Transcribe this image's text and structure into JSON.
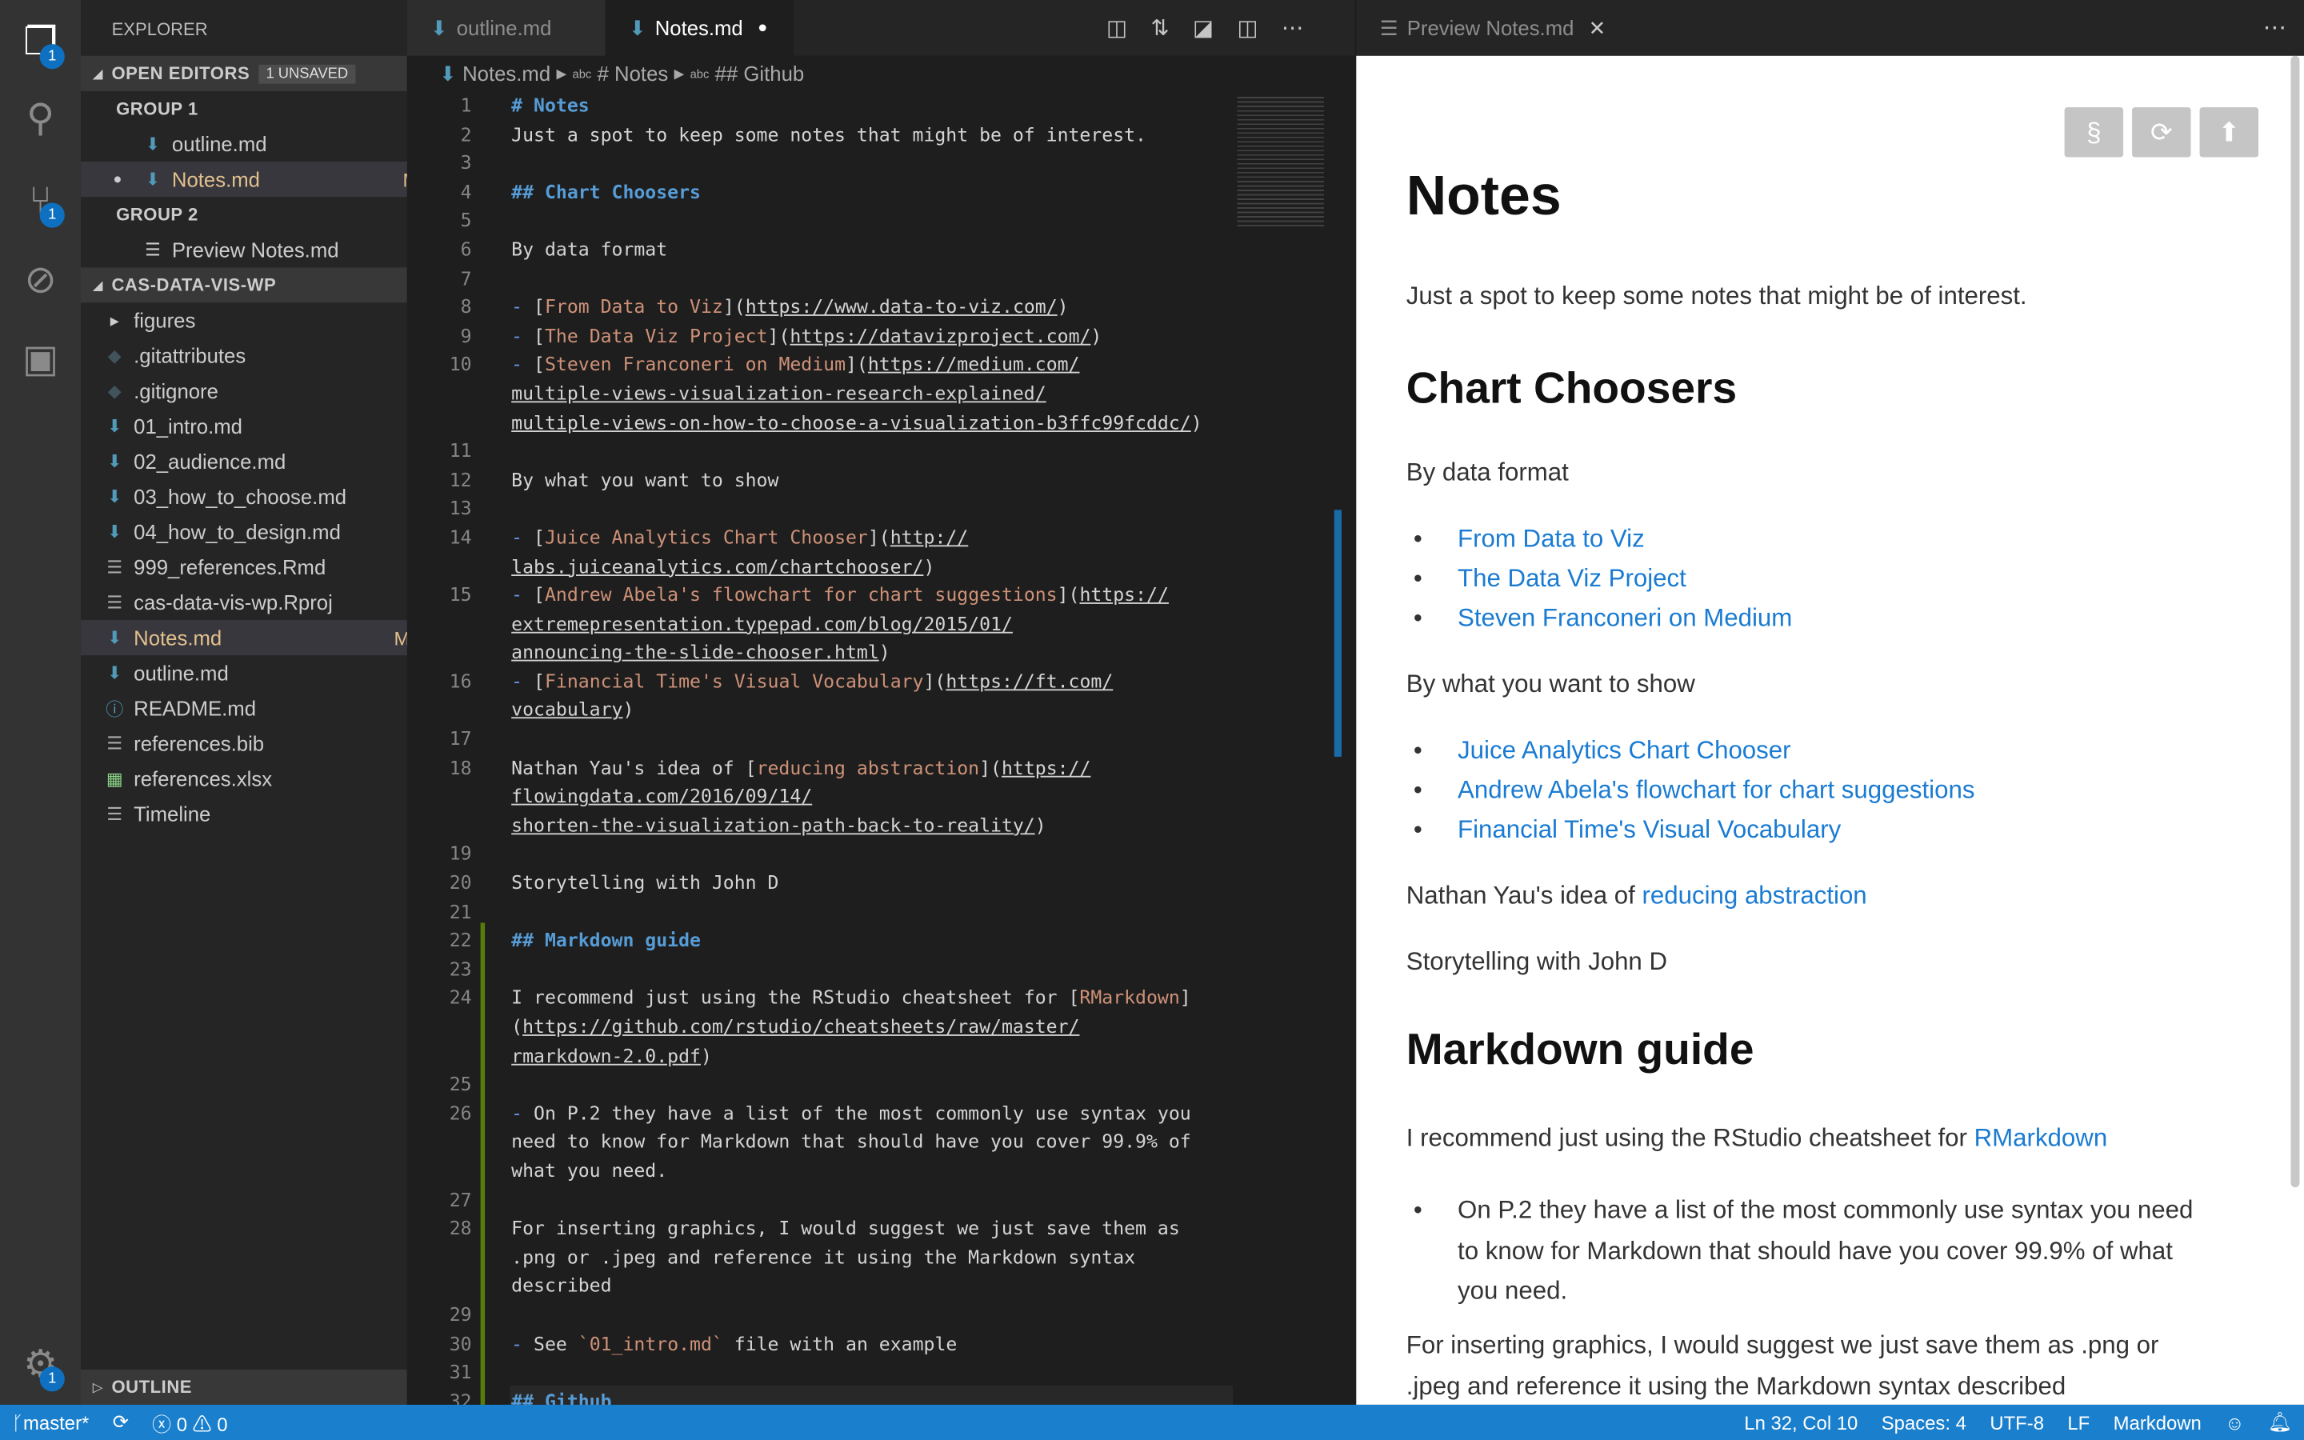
{
  "activity": {
    "explorer_badge": "1",
    "scm_badge": "1",
    "settings_badge": "1"
  },
  "sidebar": {
    "title": "EXPLORER",
    "open_editors": "OPEN EDITORS",
    "unsaved": "1 UNSAVED",
    "group1": "GROUP 1",
    "group2": "GROUP 2",
    "g1_items": [
      {
        "label": "outline.md"
      },
      {
        "label": "Notes.md",
        "flag": "M"
      }
    ],
    "g2_items": [
      {
        "label": "Preview Notes.md"
      }
    ],
    "folder": "CAS-DATA-VIS-WP",
    "files": [
      {
        "label": "figures",
        "icon": "folder"
      },
      {
        "label": ".gitattributes",
        "icon": "git"
      },
      {
        "label": ".gitignore",
        "icon": "git"
      },
      {
        "label": "01_intro.md",
        "icon": "md"
      },
      {
        "label": "02_audience.md",
        "icon": "md"
      },
      {
        "label": "03_how_to_choose.md",
        "icon": "md"
      },
      {
        "label": "04_how_to_design.md",
        "icon": "md"
      },
      {
        "label": "999_references.Rmd",
        "icon": "lines"
      },
      {
        "label": "cas-data-vis-wp.Rproj",
        "icon": "lines"
      },
      {
        "label": "Notes.md",
        "icon": "md",
        "flag": "M"
      },
      {
        "label": "outline.md",
        "icon": "md"
      },
      {
        "label": "README.md",
        "icon": "info"
      },
      {
        "label": "references.bib",
        "icon": "lines"
      },
      {
        "label": "references.xlsx",
        "icon": "xls"
      },
      {
        "label": "Timeline",
        "icon": "lines"
      }
    ],
    "outline": "OUTLINE"
  },
  "tabs": [
    {
      "label": "outline.md"
    },
    {
      "label": "Notes.md"
    }
  ],
  "breadcrumb": [
    "Notes.md",
    "# Notes",
    "## Github"
  ],
  "breadcrumb_abc": "abc",
  "code": [
    {
      "n": "1",
      "s": [
        [
          "h",
          "# Notes"
        ]
      ]
    },
    {
      "n": "2",
      "s": [
        [
          "p",
          "Just a spot to keep some notes that might be of interest."
        ]
      ]
    },
    {
      "n": "3",
      "s": []
    },
    {
      "n": "4",
      "s": [
        [
          "h",
          "## Chart Choosers"
        ]
      ]
    },
    {
      "n": "5",
      "s": []
    },
    {
      "n": "6",
      "s": [
        [
          "p",
          "By data format"
        ]
      ]
    },
    {
      "n": "7",
      "s": []
    },
    {
      "n": "8",
      "s": [
        [
          "li",
          "- "
        ],
        [
          "p",
          "["
        ],
        [
          "lt",
          "From Data to Viz"
        ],
        [
          "p",
          "]("
        ],
        [
          "u",
          "https://www.data-to-viz.com/"
        ],
        [
          "p",
          ")"
        ]
      ]
    },
    {
      "n": "9",
      "s": [
        [
          "li",
          "- "
        ],
        [
          "p",
          "["
        ],
        [
          "lt",
          "The Data Viz Project"
        ],
        [
          "p",
          "]("
        ],
        [
          "u",
          "https://datavizproject.com/"
        ],
        [
          "p",
          ")"
        ]
      ]
    },
    {
      "n": "10",
      "s": [
        [
          "li",
          "- "
        ],
        [
          "p",
          "["
        ],
        [
          "lt",
          "Steven Franconeri on Medium"
        ],
        [
          "p",
          "]("
        ],
        [
          "u",
          "https://medium.com/"
        ]
      ]
    },
    {
      "n": "",
      "s": [
        [
          "u",
          "multiple-views-visualization-research-explained/"
        ]
      ]
    },
    {
      "n": "",
      "s": [
        [
          "u",
          "multiple-views-on-how-to-choose-a-visualization-b3ffc99fcddc/"
        ],
        [
          "p",
          ")"
        ]
      ]
    },
    {
      "n": "11",
      "s": []
    },
    {
      "n": "12",
      "s": [
        [
          "p",
          "By what you want to show"
        ]
      ]
    },
    {
      "n": "13",
      "s": []
    },
    {
      "n": "14",
      "s": [
        [
          "li",
          "- "
        ],
        [
          "p",
          "["
        ],
        [
          "lt",
          "Juice Analytics Chart Chooser"
        ],
        [
          "p",
          "]("
        ],
        [
          "u",
          "http://"
        ]
      ]
    },
    {
      "n": "",
      "s": [
        [
          "u",
          "labs.juiceanalytics.com/chartchooser/"
        ],
        [
          "p",
          ")"
        ]
      ]
    },
    {
      "n": "15",
      "s": [
        [
          "li",
          "- "
        ],
        [
          "p",
          "["
        ],
        [
          "lt",
          "Andrew Abela's flowchart for chart suggestions"
        ],
        [
          "p",
          "]("
        ],
        [
          "u",
          "https://"
        ]
      ]
    },
    {
      "n": "",
      "s": [
        [
          "u",
          "extremepresentation.typepad.com/blog/2015/01/"
        ]
      ]
    },
    {
      "n": "",
      "s": [
        [
          "u",
          "announcing-the-slide-chooser.html"
        ],
        [
          "p",
          ")"
        ]
      ]
    },
    {
      "n": "16",
      "s": [
        [
          "li",
          "- "
        ],
        [
          "p",
          "["
        ],
        [
          "lt",
          "Financial Time's Visual Vocabulary"
        ],
        [
          "p",
          "]("
        ],
        [
          "u",
          "https://ft.com/"
        ]
      ]
    },
    {
      "n": "",
      "s": [
        [
          "u",
          "vocabulary"
        ],
        [
          "p",
          ")"
        ]
      ]
    },
    {
      "n": "17",
      "s": []
    },
    {
      "n": "18",
      "s": [
        [
          "p",
          "Nathan Yau's idea of ["
        ],
        [
          "lt",
          "reducing abstraction"
        ],
        [
          "p",
          "]("
        ],
        [
          "u",
          "https://"
        ]
      ]
    },
    {
      "n": "",
      "s": [
        [
          "u",
          "flowingdata.com/2016/09/14/"
        ]
      ]
    },
    {
      "n": "",
      "s": [
        [
          "u",
          "shorten-the-visualization-path-back-to-reality/"
        ],
        [
          "p",
          ")"
        ]
      ]
    },
    {
      "n": "19",
      "s": []
    },
    {
      "n": "20",
      "s": [
        [
          "p",
          "Storytelling with John D"
        ]
      ]
    },
    {
      "n": "21",
      "s": []
    },
    {
      "n": "22",
      "s": [
        [
          "h",
          "## Markdown guide"
        ]
      ]
    },
    {
      "n": "23",
      "s": []
    },
    {
      "n": "24",
      "s": [
        [
          "p",
          "I recommend just using the RStudio cheatsheet for ["
        ],
        [
          "lt",
          "RMarkdown"
        ],
        [
          "p",
          "]"
        ]
      ]
    },
    {
      "n": "",
      "s": [
        [
          "p",
          "("
        ],
        [
          "u",
          "https://github.com/rstudio/cheatsheets/raw/master/"
        ]
      ]
    },
    {
      "n": "",
      "s": [
        [
          "u",
          "rmarkdown-2.0.pdf"
        ],
        [
          "p",
          ")"
        ]
      ]
    },
    {
      "n": "25",
      "s": []
    },
    {
      "n": "26",
      "s": [
        [
          "li",
          "- "
        ],
        [
          "p",
          "On P.2 they have a list of the most commonly use syntax you"
        ]
      ]
    },
    {
      "n": "",
      "s": [
        [
          "p",
          "need to know for Markdown that should have you cover 99.9% of"
        ]
      ]
    },
    {
      "n": "",
      "s": [
        [
          "p",
          "what you need."
        ]
      ]
    },
    {
      "n": "27",
      "s": []
    },
    {
      "n": "28",
      "s": [
        [
          "p",
          "For inserting graphics, I would suggest we just save them as"
        ]
      ]
    },
    {
      "n": "",
      "s": [
        [
          "p",
          ".png or .jpeg and reference it using the Markdown syntax"
        ]
      ]
    },
    {
      "n": "",
      "s": [
        [
          "p",
          "described"
        ]
      ]
    },
    {
      "n": "29",
      "s": []
    },
    {
      "n": "30",
      "s": [
        [
          "li",
          "- "
        ],
        [
          "p",
          "See "
        ],
        [
          "c",
          "`01_intro.md`"
        ],
        [
          "p",
          " file with an example"
        ]
      ]
    },
    {
      "n": "31",
      "s": []
    },
    {
      "n": "32",
      "s": [
        [
          "h",
          "## Github"
        ]
      ]
    }
  ],
  "preview": {
    "tab": "Preview Notes.md",
    "h1": "Notes",
    "intro": "Just a spot to keep some notes that might be of interest.",
    "h2_charts": "Chart Choosers",
    "by_format": "By data format",
    "format_links": [
      "From Data to Viz",
      "The Data Viz Project",
      "Steven Franconeri on Medium"
    ],
    "by_show": "By what you want to show",
    "show_links": [
      "Juice Analytics Chart Chooser",
      "Andrew Abela's flowchart for chart suggestions",
      "Financial Time's Visual Vocabulary"
    ],
    "nathan_prefix": "Nathan Yau's idea of ",
    "nathan_link": "reducing abstraction",
    "story": "Storytelling with John D",
    "h2_md": "Markdown guide",
    "recommend_prefix": "I recommend just using the RStudio cheatsheet for ",
    "recommend_link": "RMarkdown",
    "p2_lines": [
      "On P.2 they have a list of the most commonly use syntax you need",
      "to know for Markdown that should have you cover 99.9% of what",
      "you need."
    ],
    "graphics_lines": [
      "For inserting graphics, I would suggest we just save them as .png or",
      ".jpeg and reference it using the Markdown syntax described"
    ],
    "btn_section": "§",
    "btn_refresh": "⟳",
    "btn_top": "⬆"
  },
  "status": {
    "branch": "master*",
    "errors": "0",
    "warnings": "0",
    "position": "Ln 32, Col 10",
    "spaces": "Spaces: 4",
    "encoding": "UTF-8",
    "eol": "LF",
    "language": "Markdown"
  }
}
